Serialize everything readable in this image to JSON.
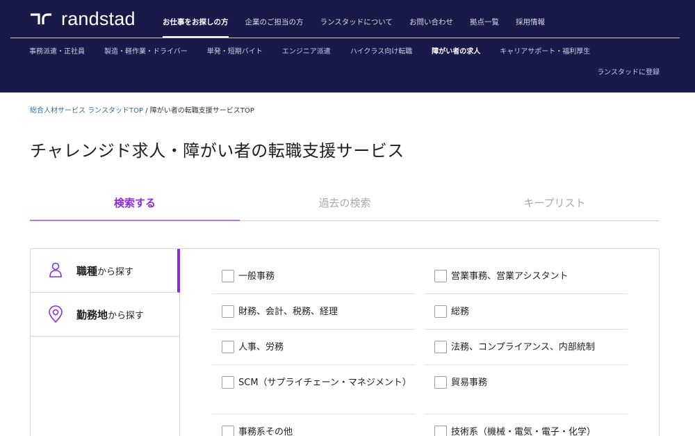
{
  "header": {
    "logo_text": "randstad",
    "top_nav": [
      {
        "label": "お仕事をお探しの方",
        "active": true
      },
      {
        "label": "企業のご担当の方",
        "active": false
      },
      {
        "label": "ランスタッドについて",
        "active": false
      },
      {
        "label": "お問い合わせ",
        "active": false
      },
      {
        "label": "拠点一覧",
        "active": false
      },
      {
        "label": "採用情報",
        "active": false
      }
    ],
    "sub_nav": [
      {
        "label": "事務派遣・正社員",
        "active": false
      },
      {
        "label": "製造・軽作業・ドライバー",
        "active": false
      },
      {
        "label": "単発・短期バイト",
        "active": false
      },
      {
        "label": "エンジニア派遣",
        "active": false
      },
      {
        "label": "ハイクラス向け転職",
        "active": false
      },
      {
        "label": "障がい者の求人",
        "active": true
      },
      {
        "label": "キャリアサポート・福利厚生",
        "active": false
      }
    ],
    "register_label": "ランスタッドに登録"
  },
  "breadcrumb": {
    "home": "総合人材サービス ランスタッドTOP",
    "separator": "/",
    "current": "障がい者の転職支援サービスTOP"
  },
  "page_title": "チャレンジド求人・障がい者の転職支援サービス",
  "tabs": [
    {
      "label": "検索する",
      "active": true
    },
    {
      "label": "過去の検索",
      "active": false
    },
    {
      "label": "キープリスト",
      "active": false
    }
  ],
  "search_side": {
    "job_type": {
      "bold": "職種",
      "rest": "から探す"
    },
    "location": {
      "bold": "勤務地",
      "rest": "から探す"
    }
  },
  "job_categories": {
    "left": [
      "一般事務",
      "財務、会計、税務、経理",
      "人事、労務",
      "SCM（サプライチェーン・マネジメント）",
      "事務系その他"
    ],
    "right": [
      "営業事務、営業アシスタント",
      "総務",
      "法務、コンプライアンス、内部統制",
      "貿易事務",
      "技術系（機械・電気・電子・化学）"
    ]
  },
  "colors": {
    "header_bg": "#191a4a",
    "accent": "#8a2be2",
    "link": "#2e6db0"
  }
}
